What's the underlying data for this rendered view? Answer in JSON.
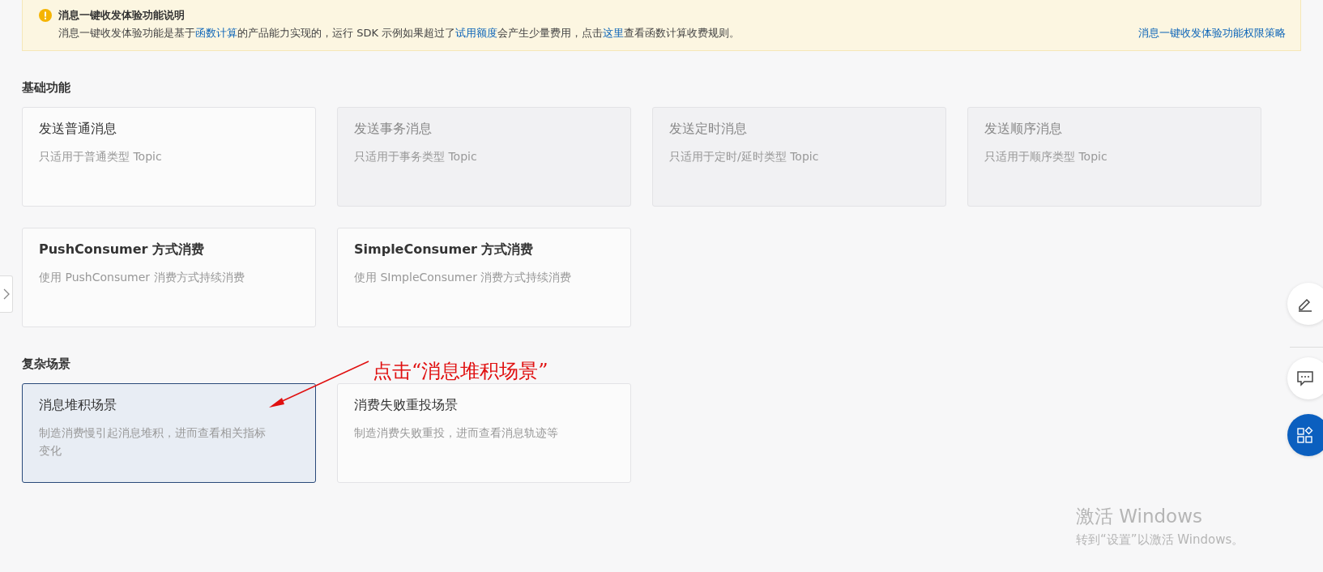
{
  "notice": {
    "title": "消息一键收发体验功能说明",
    "body": [
      {
        "kind": "text",
        "text": "消息一键收发体验功能是基于"
      },
      {
        "kind": "link",
        "text": "函数计算"
      },
      {
        "kind": "text",
        "text": "的产品能力实现的，运行 SDK 示例如果超过了"
      },
      {
        "kind": "link",
        "text": "试用额度"
      },
      {
        "kind": "text",
        "text": "会产生少量费用，点击"
      },
      {
        "kind": "link",
        "text": "这里"
      },
      {
        "kind": "text",
        "text": "查看函数计算收费规则。"
      }
    ],
    "side_link": "消息一键收发体验功能权限策略"
  },
  "sections": [
    {
      "title": "基础功能",
      "cards": [
        {
          "title": "发送普通消息",
          "desc": "只适用于普通类型 Topic",
          "disabled": false,
          "selected": false
        },
        {
          "title": "发送事务消息",
          "desc": "只适用于事务类型 Topic",
          "disabled": true,
          "selected": false
        },
        {
          "title": "发送定时消息",
          "desc": "只适用于定时/延时类型 Topic",
          "disabled": true,
          "selected": false
        },
        {
          "title": "发送顺序消息",
          "desc": "只适用于顺序类型 Topic",
          "disabled": true,
          "selected": false
        },
        {
          "title": "PushConsumer 方式消费",
          "desc": "使用 PushConsumer 消费方式持续消费",
          "disabled": false,
          "selected": false
        },
        {
          "title": "SimpleConsumer 方式消费",
          "desc": "使用 SImpleConsumer 消费方式持续消费",
          "disabled": false,
          "selected": false
        }
      ]
    },
    {
      "title": "复杂场景",
      "cards": [
        {
          "title": "消息堆积场景",
          "desc": "制造消费慢引起消息堆积，进而查看相关指标变化",
          "disabled": false,
          "selected": true
        },
        {
          "title": "消费失败重投场景",
          "desc": "制造消费失败重投，进而查看消息轨迹等",
          "disabled": false,
          "selected": false
        }
      ]
    }
  ],
  "annotation": "点击“消息堆积场景”",
  "activation": {
    "title": "激活 Windows",
    "subtitle": "转到“设置”以激活 Windows。"
  }
}
